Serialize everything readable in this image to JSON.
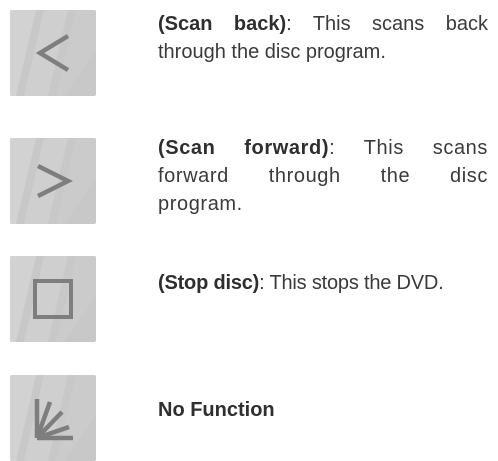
{
  "entries": [
    {
      "icon": "scan-back-icon",
      "term": "(Scan back)",
      "text": ": This scans back through the disc program."
    },
    {
      "icon": "scan-forward-icon",
      "term": "(Scan forward)",
      "text": ": This scans forward through the disc program."
    },
    {
      "icon": "stop-icon",
      "term": "(Stop disc)",
      "text": ": This stops the DVD."
    },
    {
      "icon": "fan-lines-icon",
      "term": "No Function",
      "text": ""
    }
  ],
  "colors": {
    "icon_background": "#c8c8c8",
    "icon_glyph": "#7e7e7e",
    "text": "#3a3a3a"
  }
}
